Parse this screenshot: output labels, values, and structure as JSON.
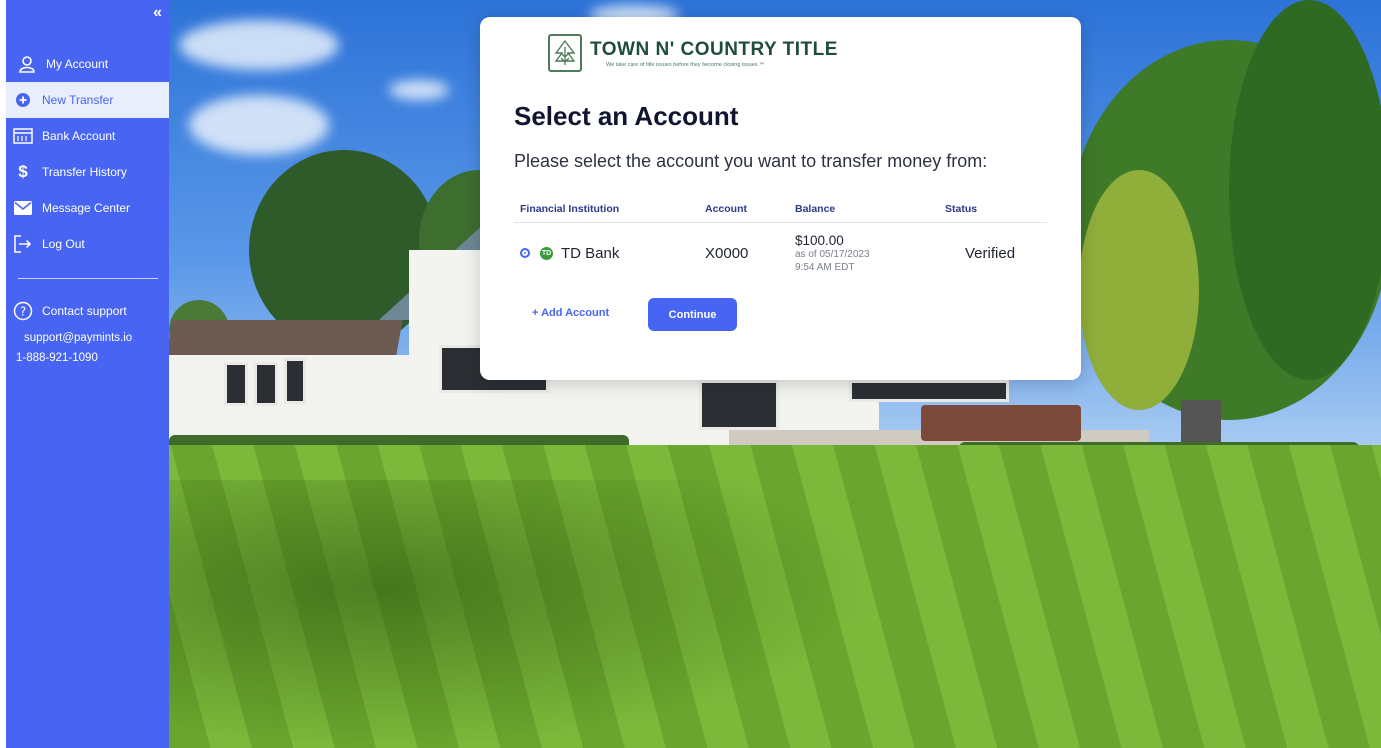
{
  "sidebar": {
    "collapse_label": "«",
    "items": [
      {
        "label": "My Account",
        "icon": "user-icon"
      },
      {
        "label": "New Transfer",
        "icon": "plus-circle-icon",
        "active": true
      },
      {
        "label": "Bank Account",
        "icon": "bank-icon"
      },
      {
        "label": "Transfer History",
        "icon": "dollar-icon"
      },
      {
        "label": "Message Center",
        "icon": "mail-icon"
      },
      {
        "label": "Log Out",
        "icon": "logout-icon"
      }
    ],
    "support": {
      "label": "Contact support",
      "email": "support@paymints.io",
      "phone": "1-888-921-1090",
      "icon": "help-icon"
    }
  },
  "brand": {
    "name": "TOWN N' COUNTRY TITLE",
    "tagline": "We take care of title issues before they become closing issues.™"
  },
  "modal": {
    "title": "Select an Account",
    "subtitle": "Please select the account you want to transfer money from:",
    "columns": [
      "Financial Institution",
      "Account",
      "Balance",
      "Status"
    ],
    "rows": [
      {
        "institution": "TD Bank",
        "bank_logo_text": "TD",
        "account": "X0000",
        "balance": "$100.00",
        "as_of": "as of 05/17/2023",
        "time": "9:54 AM EDT",
        "status": "Verified",
        "selected": true
      }
    ],
    "add_account_label": "+ Add Account",
    "continue_label": "Continue"
  },
  "colors": {
    "accent": "#4765f2",
    "sidebar_bg": "#4765f2",
    "active_item_bg": "#e8eefb",
    "brand_green": "#1f4d3a"
  }
}
